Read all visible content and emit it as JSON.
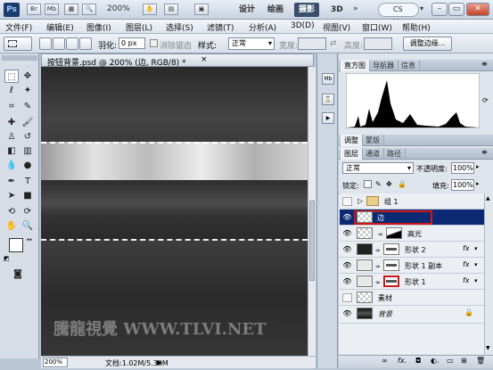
{
  "titlebar": {
    "app_logo": "Ps",
    "zoom": "200%",
    "workspaces": [
      "设计",
      "绘画",
      "摄影",
      "3D"
    ],
    "active_workspace": "摄影",
    "expand": "»",
    "cs_live": "CS Live",
    "cs_live_arrow": "▾",
    "min": "–",
    "restore": "▭",
    "close": "✕"
  },
  "menubar": {
    "items": [
      "文件(F)",
      "编辑(E)",
      "图像(I)",
      "图层(L)",
      "选择(S)",
      "滤镜(T)",
      "分析(A)",
      "3D(D)",
      "视图(V)",
      "窗口(W)",
      "帮助(H)"
    ]
  },
  "options": {
    "feather_label": "羽化:",
    "feather_value": "0 px",
    "antialias_label": "消除锯齿",
    "style_label": "样式:",
    "style_value": "正常",
    "width_label": "宽度:",
    "height_label": "高度:",
    "refine_edge_label": "调整边缘..."
  },
  "document": {
    "tab_title": "按钮背景.psd @ 200% (边, RGB/8) *",
    "tab_close": "×",
    "zoom": "200%",
    "doc_info": "文档:1.02M/5.30M",
    "watermark": "騰龍視覺 WWW.TLVI.NET"
  },
  "panels": {
    "top_tabs": [
      "直方图",
      "导航器",
      "信息"
    ],
    "top_active": "直方图",
    "adj_tabs": [
      "调整",
      "蒙版"
    ],
    "adj_active": "调整",
    "layer_tabs": [
      "图层",
      "通道",
      "路径"
    ],
    "layer_active": "图层",
    "blend_mode": "正常",
    "opacity_label": "不透明度:",
    "opacity_value": "100%",
    "lock_label": "锁定:",
    "fill_label": "填充:",
    "fill_value": "100%",
    "group_name": "组 1",
    "layers": [
      {
        "name": "边",
        "selected": true
      },
      {
        "name": "高光",
        "selected": false
      },
      {
        "name": "形状 2",
        "selected": false,
        "fx": "fx"
      },
      {
        "name": "形状 1 副本",
        "selected": false,
        "fx": "fx"
      },
      {
        "name": "形状 1",
        "selected": false,
        "fx": "fx"
      },
      {
        "name": "素材",
        "selected": false
      },
      {
        "name": "背景",
        "selected": false
      }
    ],
    "bottom_icons": [
      "link-icon",
      "fx-icon",
      "mask-icon",
      "adjustment-icon",
      "folder-icon",
      "new-layer-icon",
      "trash-icon"
    ],
    "bottom_labels": [
      "∞",
      "fx.",
      "◘",
      "◐.",
      "▭",
      "⊞",
      "🗑"
    ]
  },
  "colors": {
    "selected_layer": "#0b2a73",
    "highlight_box": "#d01818",
    "panel_bg": "#dfe5ed"
  }
}
